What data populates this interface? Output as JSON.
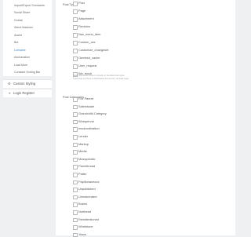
{
  "sidebar": {
    "items": [
      {
        "label": "Import/Export Constants",
        "active": false
      },
      {
        "label": "Social Share",
        "active": false
      },
      {
        "label": "Goldat",
        "active": false
      },
      {
        "label": "Wend Madcrun",
        "active": false
      },
      {
        "label": "Auslet",
        "active": false
      },
      {
        "label": "Bot",
        "active": false
      },
      {
        "label": "Loimaine",
        "active": true
      },
      {
        "label": "Anchanation",
        "active": false
      },
      {
        "label": "Load More",
        "active": false
      },
      {
        "label": "Constant Sorting Bar",
        "active": false
      }
    ],
    "sections": [
      {
        "icon": "settings-icon",
        "glyph": "⚙",
        "label": "Custom Styling"
      },
      {
        "icon": "login-icon",
        "glyph": "⇥",
        "label": "Login Register"
      }
    ]
  },
  "post_type": {
    "label": "Post Type",
    "options": [
      "Post",
      "Page",
      "Attachment",
      "Revision",
      "Nav_menu_item",
      "Custom_css",
      "Customize_changeset",
      "Oembed_cache",
      "User_request",
      "Wp_block"
    ],
    "help_lines": [
      "Select the check boxes to include on the Reformed types.",
      "Types that are there to disturbance document 1 unusual types."
    ]
  },
  "post_categories": {
    "label": "Post Categories",
    "options": [
      "Fox Parent",
      "Saleintuiale",
      "Grandchild Category",
      "Womperval",
      "Insubordination",
      "Lender",
      "Markup",
      "Media",
      "Mossychatic",
      "Parchthread",
      "Patter",
      "Papillonaceous",
      "Unpublished",
      "Unestuerated",
      "Brains",
      "Northead",
      "Reimitentioned",
      "Whetstone",
      "Years"
    ]
  },
  "colors": {
    "accent": "#3b82c4",
    "background": "#eef0f2",
    "panel": "#ffffff"
  }
}
